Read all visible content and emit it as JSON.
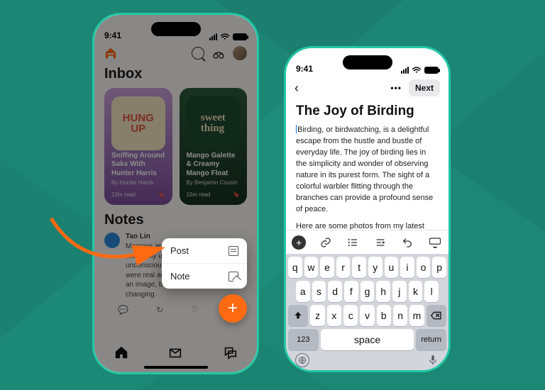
{
  "status": {
    "time": "9:41"
  },
  "left": {
    "inbox_title": "Inbox",
    "notes_title": "Notes",
    "cards": [
      {
        "art_line1": "HUNG",
        "art_line2": "UP",
        "title": "Sniffing Around Saks With Hunter Harris",
        "author": "By Hunter Harris",
        "readtime": "12m read"
      },
      {
        "art_line1": "sweet",
        "art_line2": "thing",
        "title": "Mango Galette & Creamy Mango Float",
        "author": "By Benjamin Cousin",
        "readtime": "15m read"
      }
    ],
    "note": {
      "author": "Tao Lin",
      "text": "Memoirs are woefully incomplete and extremely unconscious. We unconsciously choose what we wish were real and make sense based on an image, both of which are always changing."
    },
    "tabs": {
      "home": "home",
      "inbox": "inbox",
      "chat": "chat"
    }
  },
  "compose_menu": {
    "post": "Post",
    "note": "Note"
  },
  "right": {
    "next": "Next",
    "title": "The Joy of Birding",
    "para1": "Birding, or birdwatching, is a delightful escape from the hustle and bustle of everyday life. The joy of birding lies in the simplicity and wonder of observing nature in its purest form. The sight of a colorful warbler flitting through the branches can provide a profound sense of peace.",
    "para2": "Here are some photos from my latest jaunt."
  },
  "keyboard": {
    "row1": [
      "q",
      "w",
      "e",
      "r",
      "t",
      "y",
      "u",
      "i",
      "o",
      "p"
    ],
    "row2": [
      "a",
      "s",
      "d",
      "f",
      "g",
      "h",
      "j",
      "k",
      "l"
    ],
    "row3": [
      "z",
      "x",
      "c",
      "v",
      "b",
      "n",
      "m"
    ],
    "numkey": "123",
    "space": "space",
    "return": "return"
  }
}
